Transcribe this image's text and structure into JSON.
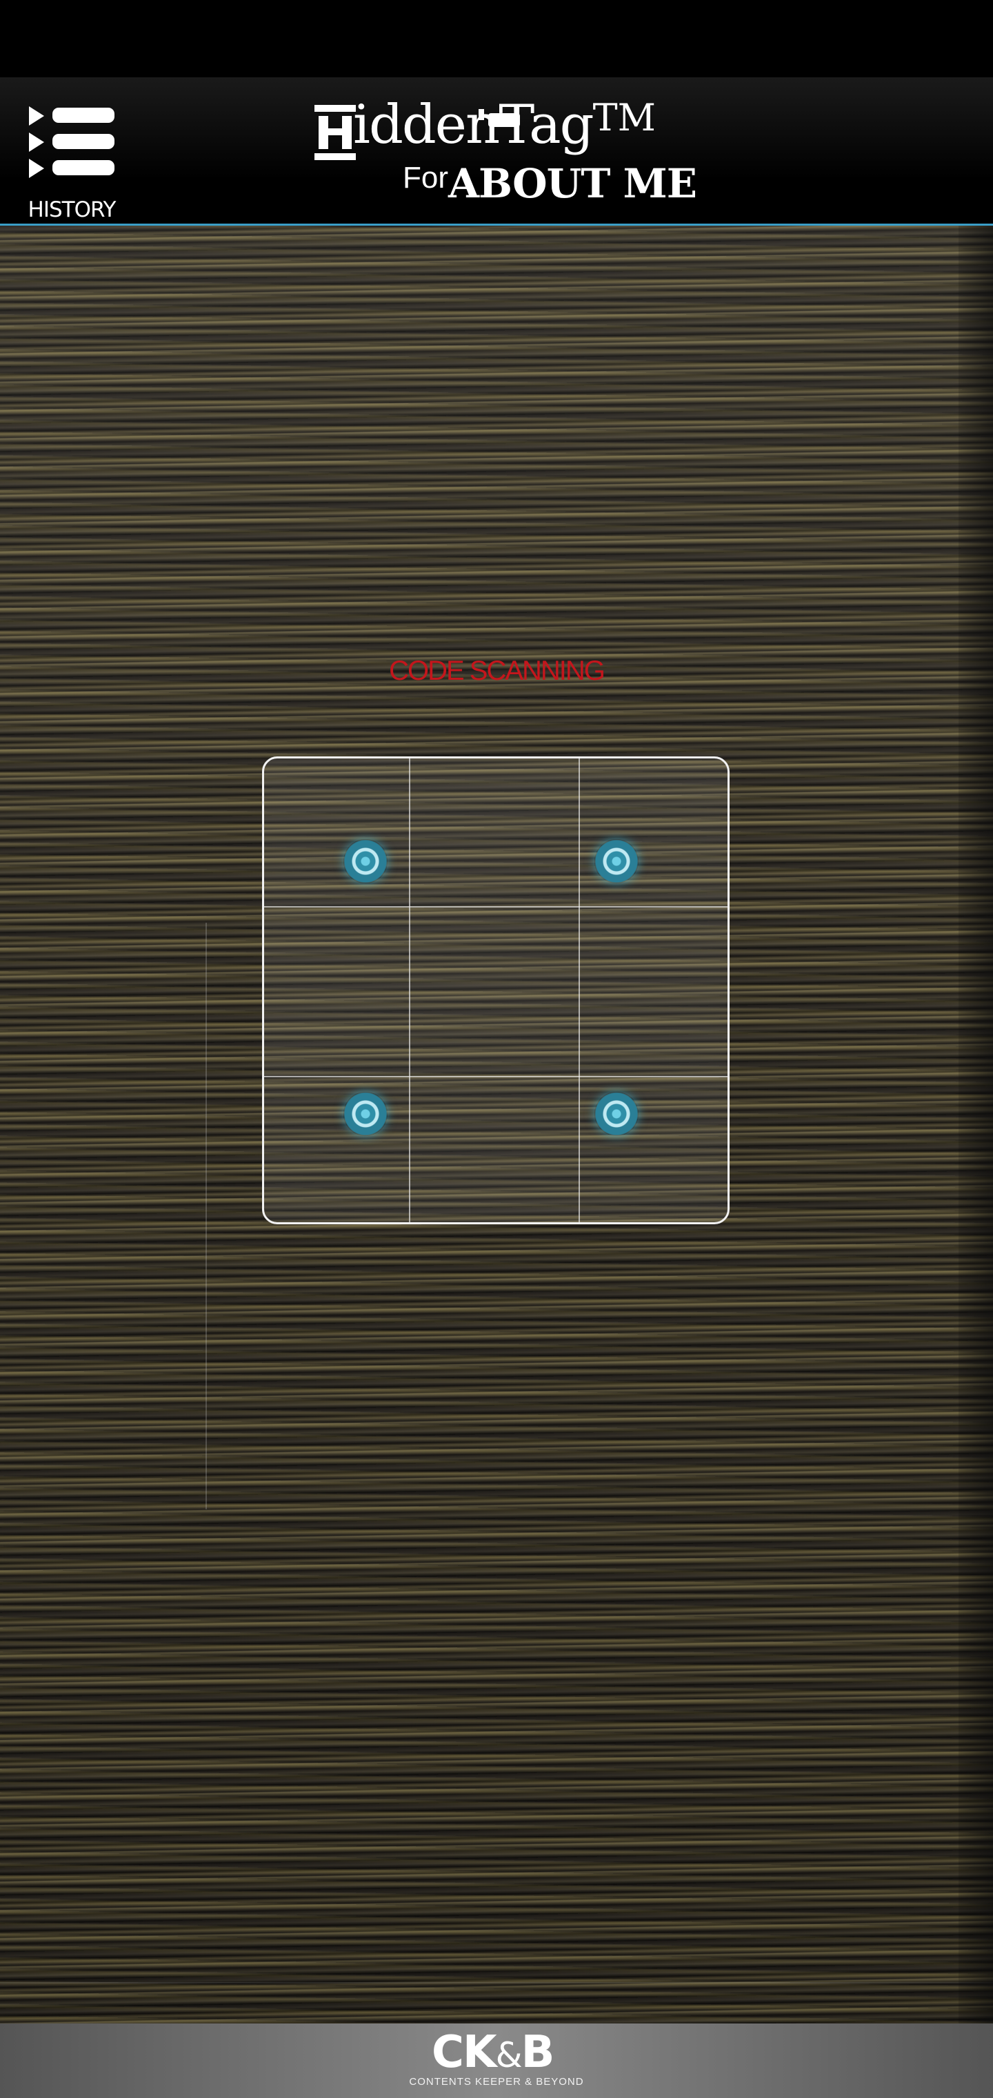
{
  "header": {
    "history_label": "HISTORY",
    "brand": {
      "name": "iddenTag",
      "trademark": "TM",
      "subtitle_prefix": "For",
      "subtitle_main": "ABOUT ME"
    },
    "accent_color": "#3a9ec7"
  },
  "scanner": {
    "status_text": "CODE SCANNING",
    "status_color": "#c4161c",
    "markers": [
      "target-marker",
      "target-marker",
      "target-marker",
      "target-marker"
    ]
  },
  "footer": {
    "logo_text": "CK",
    "logo_amp": "&",
    "logo_tail": "B",
    "tagline": "CONTENTS KEEPER & BEYOND"
  }
}
